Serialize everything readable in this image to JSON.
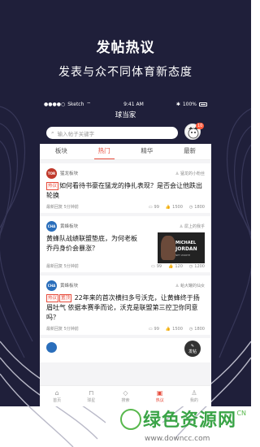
{
  "colors": {
    "background": "#1f1f3a",
    "accent": "#e74c3c",
    "watermark": "#3aa447"
  },
  "headline": "发帖热议",
  "subheadline": "发表与众不同体育新态度",
  "status": {
    "carrier": "Sketch",
    "time": "9:41 AM",
    "battery": "100%"
  },
  "app": {
    "title": "球当家",
    "search_placeholder": "输入帖子关键字",
    "notification_count": "10"
  },
  "tabs": [
    "板块",
    "热门",
    "精华",
    "最新"
  ],
  "posts": [
    {
      "board": "猛龙板块",
      "board_logo": "TOR",
      "user": "猛龙的小粉丝",
      "tags": [
        "热议"
      ],
      "title": "如何看待书豪在猛龙的挣扎表现？是否会让他跌出轮换",
      "time": "最新回复 5分钟前",
      "comments": "99",
      "likes": "1500",
      "views": "1800"
    },
    {
      "board": "黄蜂板块",
      "board_logo": "CHA",
      "user": "屌上的我乎",
      "tags": [],
      "title": "黄蜂队战绩联盟垫底，为何老板乔丹身价会暴涨？",
      "time": "最新回复 5分钟前",
      "comments": "99",
      "likes": "120",
      "views": "1200",
      "image": {
        "line1": "MICHAEL",
        "line2": "JORDAN",
        "line3": "NET WORTH"
      }
    },
    {
      "board": "黄蜂板块",
      "board_logo": "CHA",
      "user": "蛤大罐的仙女",
      "tags": [
        "热议",
        "置顶"
      ],
      "title": "22年来的首次横扫多号沃克，让黄蜂终于扬眉吐气  依据本赛季而论，沃克是联盟第三控卫你同意吗？",
      "time": "最新回复 5分钟前",
      "comments": "99",
      "likes": "1500",
      "views": "1800"
    }
  ],
  "fab_label": "发帖",
  "nav": [
    "首页",
    "球星",
    "搜索",
    "热议",
    "我的"
  ],
  "watermark": {
    "text": "绿色资源网",
    "url": "www.downcc.com",
    "logo": "CN"
  }
}
